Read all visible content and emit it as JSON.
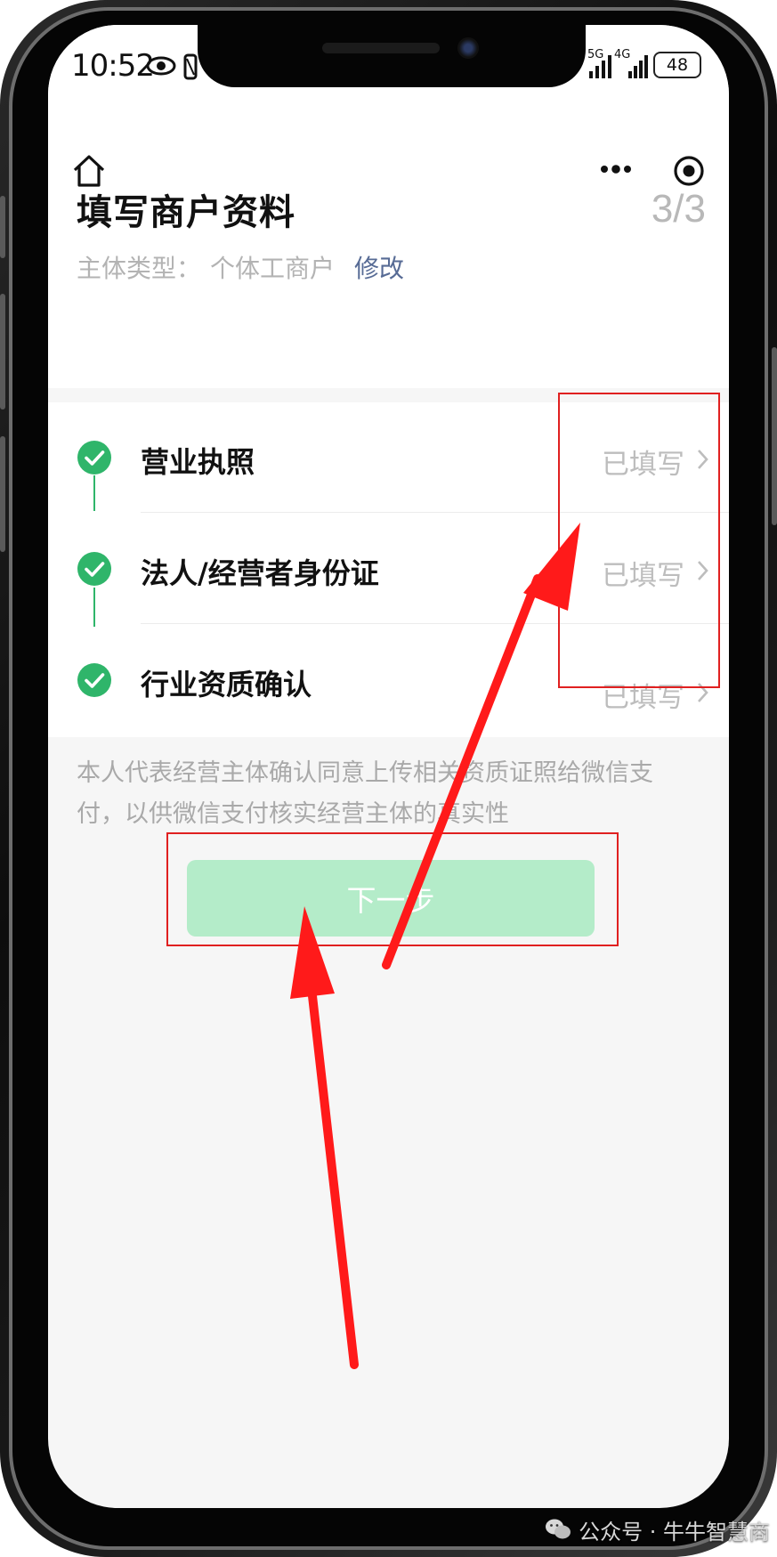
{
  "status_bar": {
    "time": "10:52",
    "network_1": "5G",
    "network_2": "4G",
    "battery": "48"
  },
  "header": {
    "title": "填写商户资料",
    "step_count": "3/3",
    "subject_type_label": "主体类型：",
    "subject_type_value": "个体工商户",
    "modify_link": "修改"
  },
  "steps": [
    {
      "label": "营业执照",
      "status": "已填写",
      "done": true
    },
    {
      "label": "法人/经营者身份证",
      "status": "已填写",
      "done": true
    },
    {
      "label": "行业资质确认",
      "status": "已填写",
      "done": true
    }
  ],
  "consent": {
    "text": "本人代表经营主体确认同意上传相关资质证照给微信支付，以供微信支付核实经营主体的真实性"
  },
  "next_button": {
    "label": "下一步",
    "enabled": false
  },
  "colors": {
    "check_green": "#2fb56a",
    "button_disabled": "#b4ecc9",
    "link_blue": "#576b95",
    "annotation_red": "#e02020"
  },
  "icons": [
    "home-icon",
    "more-icon",
    "close-mini-icon",
    "check-icon",
    "chevron-right-icon",
    "wechat-icon"
  ],
  "watermark": {
    "text": "公众号 · 牛牛智慧商"
  }
}
